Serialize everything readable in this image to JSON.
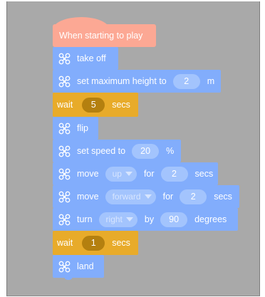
{
  "start_block": {
    "label": "When starting to play"
  },
  "blocks": [
    {
      "kind": "drone",
      "label": "take off"
    },
    {
      "kind": "drone",
      "label": "set maximum height to",
      "value": "2",
      "unit": "m"
    },
    {
      "kind": "wait",
      "label": "wait",
      "value": "5",
      "unit": "secs"
    },
    {
      "kind": "drone",
      "label": "flip"
    },
    {
      "kind": "drone",
      "label": "set speed to",
      "value": "20",
      "unit": "%"
    },
    {
      "kind": "drone",
      "label": "move",
      "direction": "up",
      "mid": "for",
      "value": "2",
      "unit": "secs"
    },
    {
      "kind": "drone",
      "label": "move",
      "direction": "forward",
      "mid": "for",
      "value": "2",
      "unit": "secs"
    },
    {
      "kind": "drone",
      "label": "turn",
      "direction": "right",
      "mid": "by",
      "value": "90",
      "unit": "degrees"
    },
    {
      "kind": "wait",
      "label": "wait",
      "value": "1",
      "unit": "secs"
    },
    {
      "kind": "drone",
      "label": "land"
    }
  ],
  "icons": {
    "drone_block": "drone-icon"
  },
  "colors": {
    "canvas": "#a9a9a9",
    "start_block": "#fca894",
    "drone_block": "#82adfc",
    "wait_block": "#e8ab2a",
    "wait_value_pill": "#b4800f",
    "drone_value_pill": "#a3c4fd"
  }
}
